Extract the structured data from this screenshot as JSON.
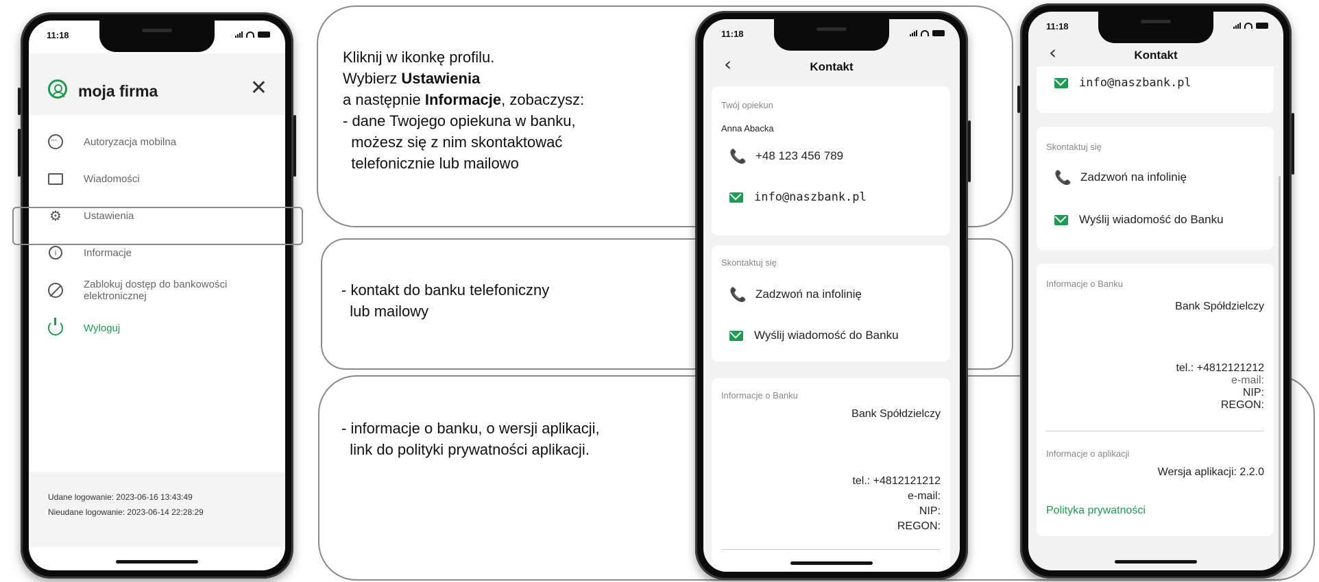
{
  "phone1": {
    "time": "11:18",
    "profile_name": "moja firma",
    "close_icon": "close-icon",
    "menu": [
      {
        "label": "Autoryzacja mobilna",
        "icon": "mobile-auth-icon"
      },
      {
        "label": "Wiadomości",
        "icon": "message-icon"
      },
      {
        "label": "Ustawienia",
        "icon": "gear-icon"
      },
      {
        "label": "Informacje",
        "icon": "info-icon"
      },
      {
        "label": "Zablokuj dostęp do bankowości elektronicznej",
        "icon": "block-icon"
      },
      {
        "label": "Wyloguj",
        "icon": "power-icon"
      }
    ],
    "last_login_ok": "Udane logowanie: 2023-06-16 13:43:49",
    "last_login_fail": "Nieudane logowanie: 2023-06-14 22:28:29"
  },
  "callouts": {
    "text1_line1": "Kliknij w ikonkę profilu.",
    "text1_line2_prefix": "Wybierz ",
    "text1_line2_bold": "Ustawienia",
    "text1_line3_prefix": "a następnie ",
    "text1_line3_bold": "Informacje",
    "text1_line3_suffix": ", zobaczysz:",
    "text1_line4": "- dane Twojego opiekuna w banku,",
    "text1_line5": "  możesz się z nim skontaktować",
    "text1_line6": "  telefonicznie lub mailowo",
    "text2_line1": "- kontakt do banku telefoniczny",
    "text2_line2": "  lub mailowy",
    "text3_line1": "- informacje o banku, o wersji aplikacji,",
    "text3_line2": "  link do polityki prywatności aplikacji."
  },
  "phone2": {
    "time": "11:18",
    "title": "Kontakt",
    "advisor_label": "Twój opiekun",
    "advisor_name": "Anna Abacka",
    "advisor_phone": "+48 123 456 789",
    "advisor_email": "info@naszbank.pl",
    "contact_label": "Skontaktuj się",
    "call_hotline": "Zadzwoń na infolinię",
    "send_message": "Wyślij wiadomość do Banku",
    "bank_info_label": "Informacje o Banku",
    "bank_name": "Bank Spółdzielczy",
    "bank_tel": "tel.: +4812121212",
    "bank_email": "e-mail:",
    "bank_nip": "NIP:",
    "bank_regon": "REGON:"
  },
  "phone3": {
    "time": "11:18",
    "title": "Kontakt",
    "advisor_email": "info@naszbank.pl",
    "contact_label": "Skontaktuj się",
    "call_hotline": "Zadzwoń na infolinię",
    "send_message": "Wyślij wiadomość do Banku",
    "bank_info_label": "Informacje o Banku",
    "bank_name": "Bank Spółdzielczy",
    "bank_tel": "tel.: +4812121212",
    "bank_email": "e-mail:",
    "bank_nip": "NIP:",
    "bank_regon": "REGON:",
    "app_info_label": "Informacje o aplikacji",
    "app_version": "Wersja aplikacji: 2.2.0",
    "privacy_policy": "Polityka prywatności"
  },
  "colors": {
    "accent_green": "#1e9b52",
    "callout_border": "#8a8a8a",
    "screen_bg": "#f2f2f2"
  }
}
